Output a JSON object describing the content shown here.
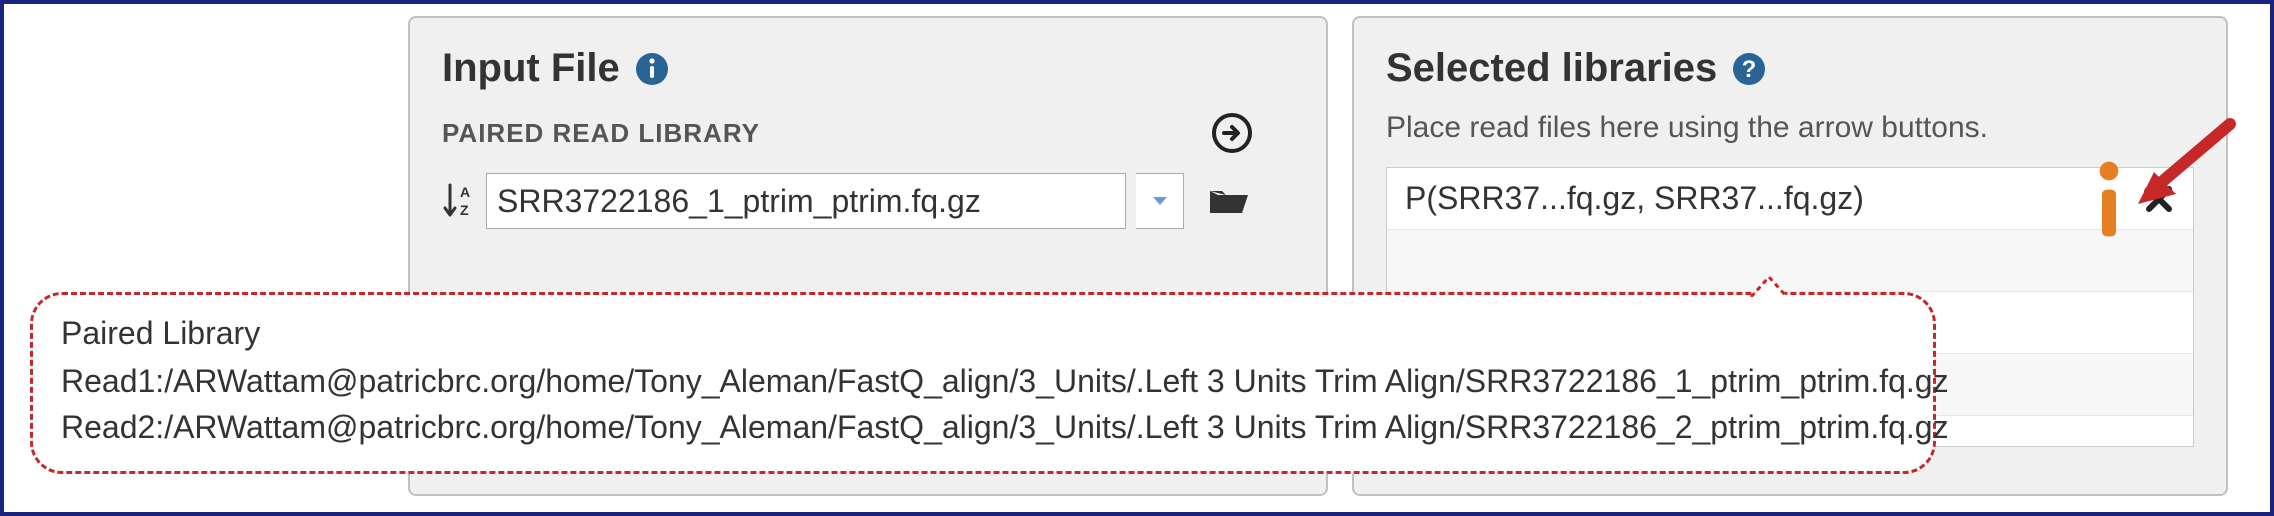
{
  "left_panel": {
    "title": "Input File",
    "subheader": "PAIRED READ LIBRARY",
    "input_value": "SRR3722186_1_ptrim_ptrim.fq.gz"
  },
  "right_panel": {
    "title": "Selected libraries",
    "description": "Place read files here using the arrow buttons.",
    "items": [
      {
        "label": "P(SRR37...fq.gz, SRR37...fq.gz)"
      }
    ]
  },
  "tooltip": {
    "title": "Paired Library",
    "read1": "Read1:/ARWattam@patricbrc.org/home/Tony_Aleman/FastQ_align/3_Units/.Left 3 Units Trim Align/SRR3722186_1_ptrim_ptrim.fq.gz",
    "read2": "Read2:/ARWattam@patricbrc.org/home/Tony_Aleman/FastQ_align/3_Units/.Left 3 Units Trim Align/SRR3722186_2_ptrim_ptrim.fq.gz"
  }
}
